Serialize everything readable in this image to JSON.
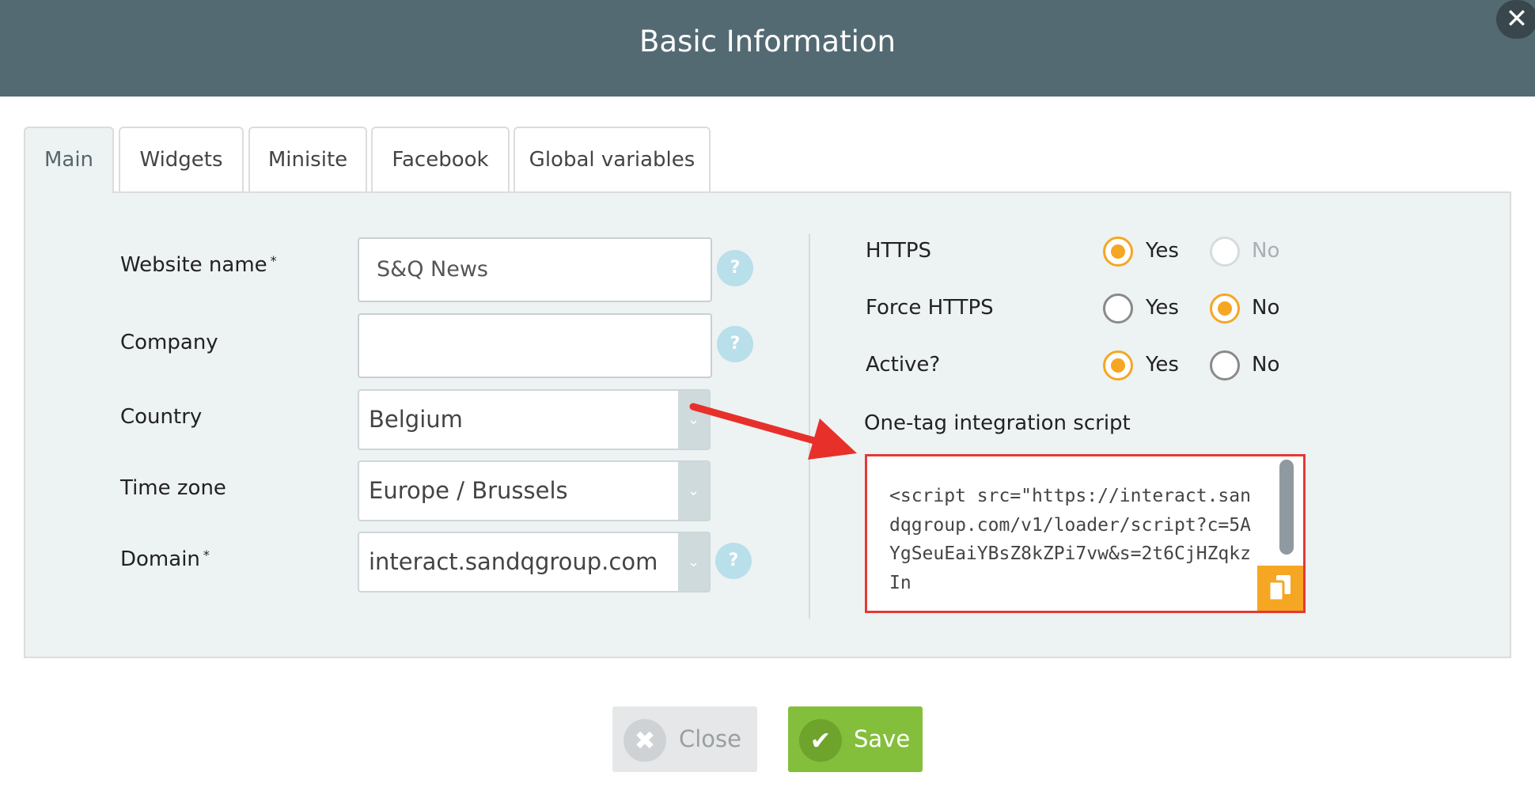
{
  "dialog": {
    "title": "Basic Information"
  },
  "tabs": [
    {
      "label": "Main",
      "active": true
    },
    {
      "label": "Widgets"
    },
    {
      "label": "Minisite"
    },
    {
      "label": "Facebook"
    },
    {
      "label": "Global variables"
    }
  ],
  "form": {
    "website_name": {
      "label": "Website name",
      "required_mark": "*",
      "value": "S&Q News"
    },
    "company": {
      "label": "Company",
      "value": ""
    },
    "country": {
      "label": "Country",
      "value": "Belgium"
    },
    "time_zone": {
      "label": "Time zone",
      "value": "Europe / Brussels"
    },
    "domain": {
      "label": "Domain",
      "required_mark": "*",
      "value": "interact.sandqgroup.com"
    },
    "help_glyph": "?"
  },
  "settings": {
    "yes_label": "Yes",
    "no_label": "No",
    "https": {
      "label": "HTTPS",
      "selected": "Yes",
      "no_disabled": true
    },
    "force_https": {
      "label": "Force HTTPS",
      "selected": "No"
    },
    "active": {
      "label": "Active?",
      "selected": "Yes"
    }
  },
  "script": {
    "label": "One-tag integration script",
    "value": "<script src=\"https://interact.sandqgroup.com/v1/loader/script?c=5AYgSeuEaiYBsZ8kZPi7vw&s=2t6CjHZqkzIn"
  },
  "footer": {
    "close_label": "Close",
    "save_label": "Save"
  },
  "colors": {
    "header": "#546a72",
    "accent_radio": "#f5a623",
    "save_button": "#84bf3c",
    "highlight": "#e53935"
  },
  "icons": {
    "close": "close-icon",
    "help": "question-icon",
    "dropdown": "chevron-down-icon",
    "copy": "copy-icon",
    "check": "check-icon",
    "cross": "cross-icon",
    "arrow": "annotation-arrow"
  }
}
